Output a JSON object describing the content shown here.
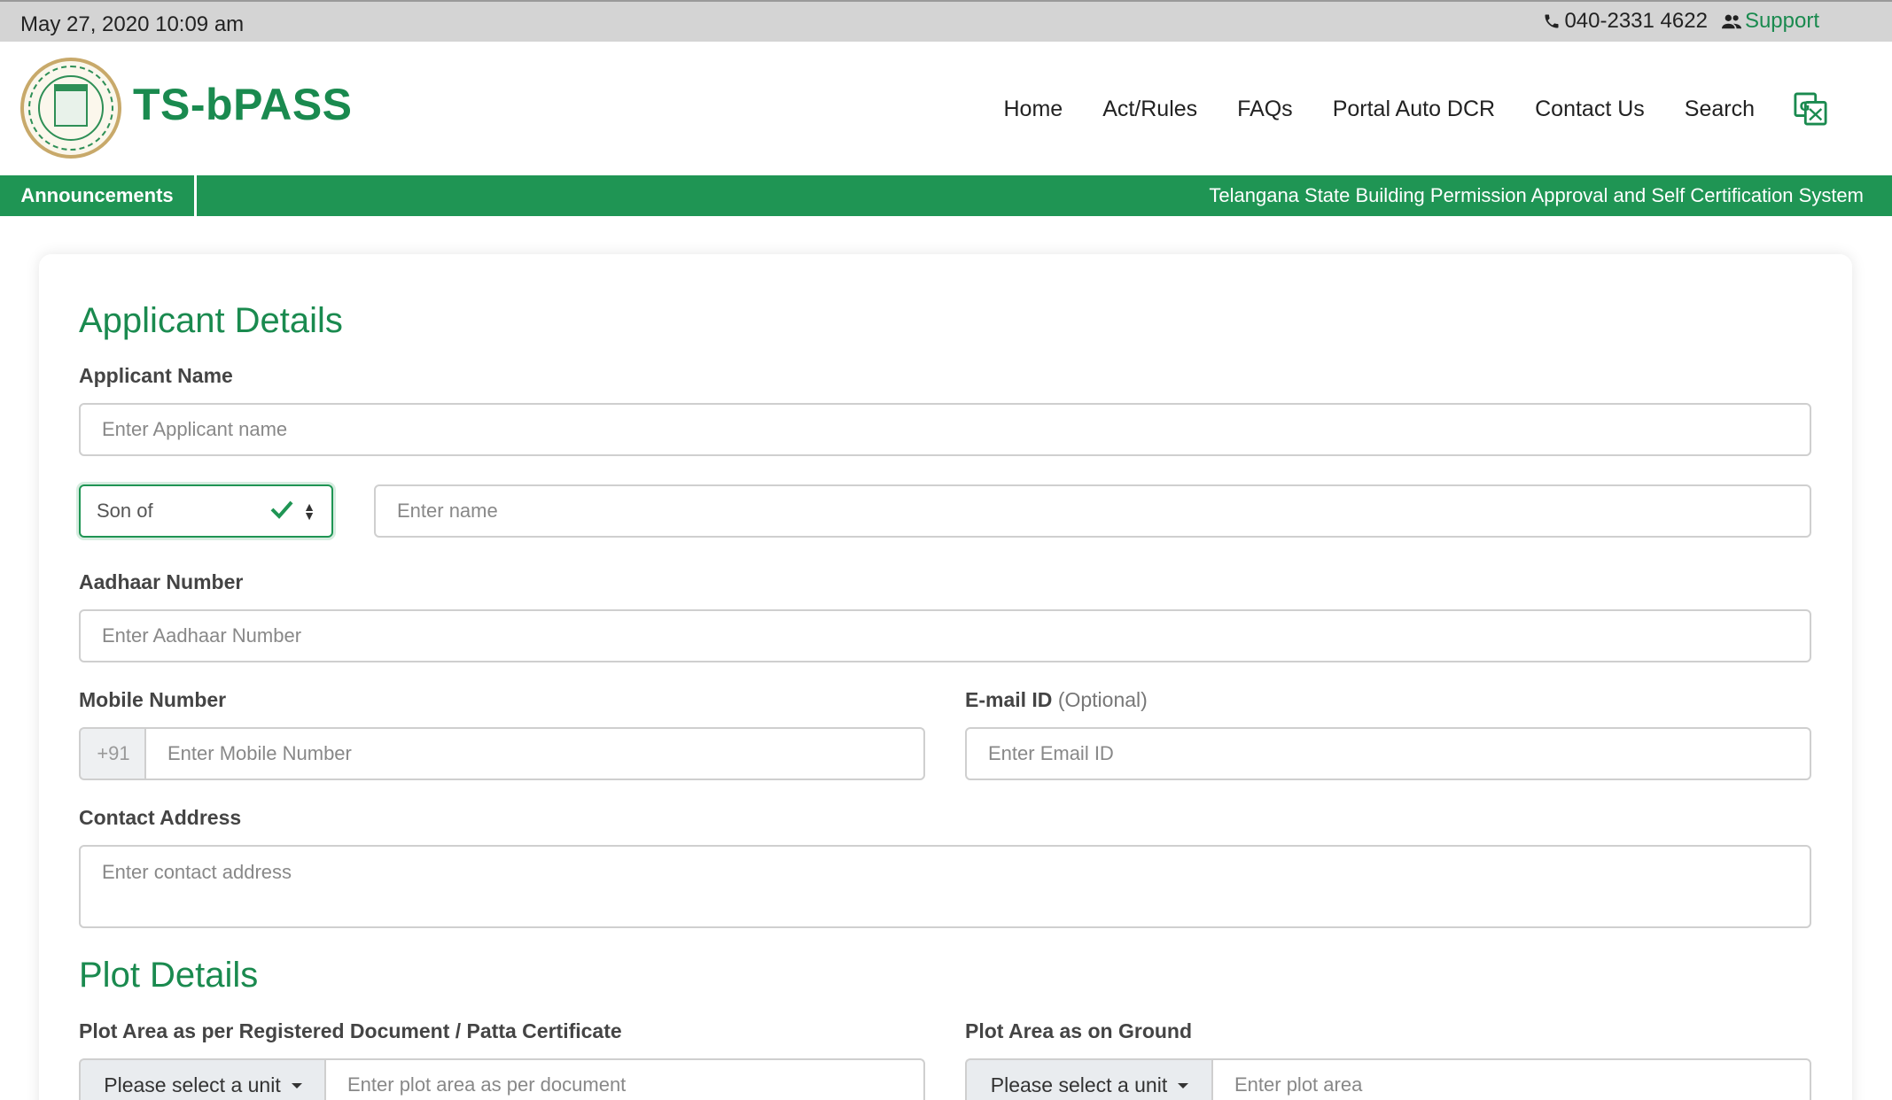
{
  "topbar": {
    "datetime": "May 27, 2020 10:09 am",
    "phone": "040-2331 4622",
    "support": "Support"
  },
  "header": {
    "brand": "TS-bPASS",
    "nav": [
      "Home",
      "Act/Rules",
      "FAQs",
      "Portal Auto DCR",
      "Contact Us",
      "Search"
    ]
  },
  "announcements": {
    "label": "Announcements",
    "ticker": "Telangana State Building Permission Approval and Self Certification System"
  },
  "applicant": {
    "title": "Applicant Details",
    "name_label": "Applicant Name",
    "name_placeholder": "Enter Applicant name",
    "relation_selected": "Son of",
    "relation_name_placeholder": "Enter name",
    "aadhaar_label": "Aadhaar Number",
    "aadhaar_placeholder": "Enter Aadhaar Number",
    "mobile_label": "Mobile Number",
    "mobile_prefix": "+91",
    "mobile_placeholder": "Enter Mobile Number",
    "email_label": "E-mail ID",
    "email_optional": "(Optional)",
    "email_placeholder": "Enter Email ID",
    "address_label": "Contact Address",
    "address_placeholder": "Enter contact address"
  },
  "plot": {
    "title": "Plot Details",
    "doc_area_label": "Plot Area as per Registered Document / Patta Certificate",
    "doc_unit": "Please select a unit",
    "doc_area_placeholder": "Enter plot area as per document",
    "ground_area_label": "Plot Area as on Ground",
    "ground_unit": "Please select a unit",
    "ground_area_placeholder": "Enter plot area"
  },
  "colors": {
    "brand_green": "#1a8a4f",
    "bar_green": "#1f9554"
  }
}
